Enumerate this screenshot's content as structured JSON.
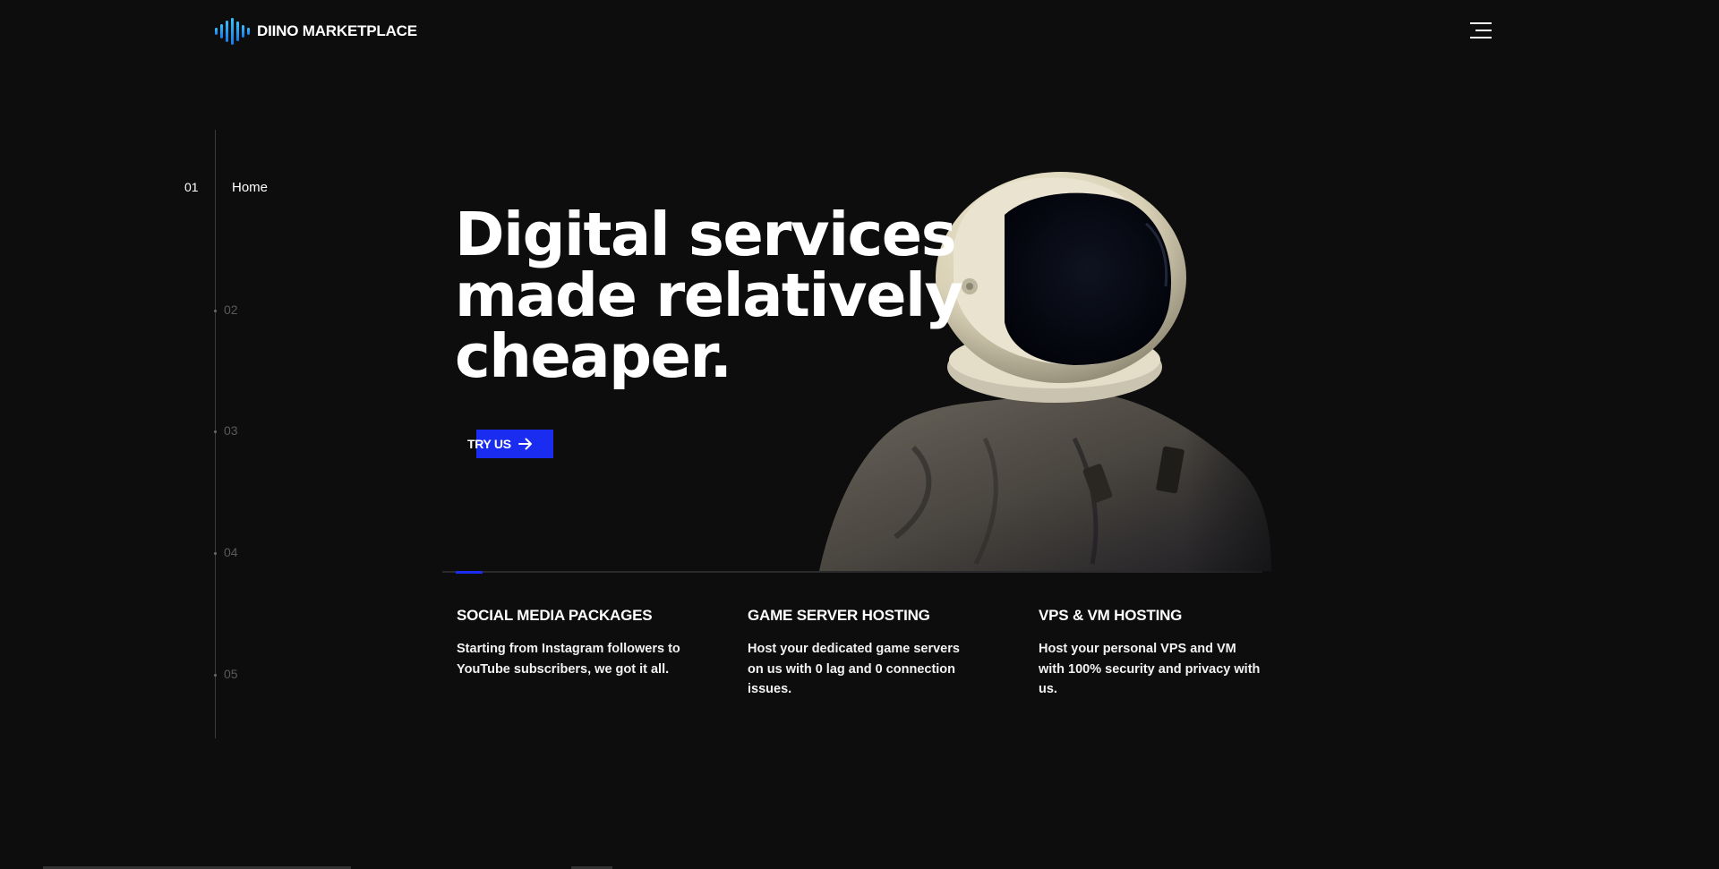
{
  "header": {
    "brand": "DIINO MARKETPLACE",
    "logo_icon": "soundwave-icon",
    "menu_icon": "hamburger-menu-icon"
  },
  "sidebar": {
    "items": [
      {
        "number": "01",
        "label": "Home",
        "active": true
      },
      {
        "number": "02",
        "active": false
      },
      {
        "number": "03",
        "active": false
      },
      {
        "number": "04",
        "active": false
      },
      {
        "number": "05",
        "active": false
      }
    ]
  },
  "hero": {
    "title_lines": [
      "Digital services",
      "made relatively",
      "cheaper."
    ],
    "cta_label": "TRY US",
    "cta_icon": "arrow-right-icon",
    "image": "astronaut-image"
  },
  "services": [
    {
      "title": "SOCIAL MEDIA PACKAGES",
      "description": "Starting from Instagram followers to YouTube subscribers, we got it all."
    },
    {
      "title": "GAME SERVER HOSTING",
      "description": "Host your dedicated game servers on us with 0 lag and 0 connection issues."
    },
    {
      "title": "VPS & VM HOSTING",
      "description": "Host your personal VPS and VM with 100% security and privacy with us."
    }
  ],
  "colors": {
    "background": "#0d0d0e",
    "accent": "#1a2cf0",
    "logo_gradient_top": "#34c3ff",
    "logo_gradient_bottom": "#1a78e6"
  }
}
